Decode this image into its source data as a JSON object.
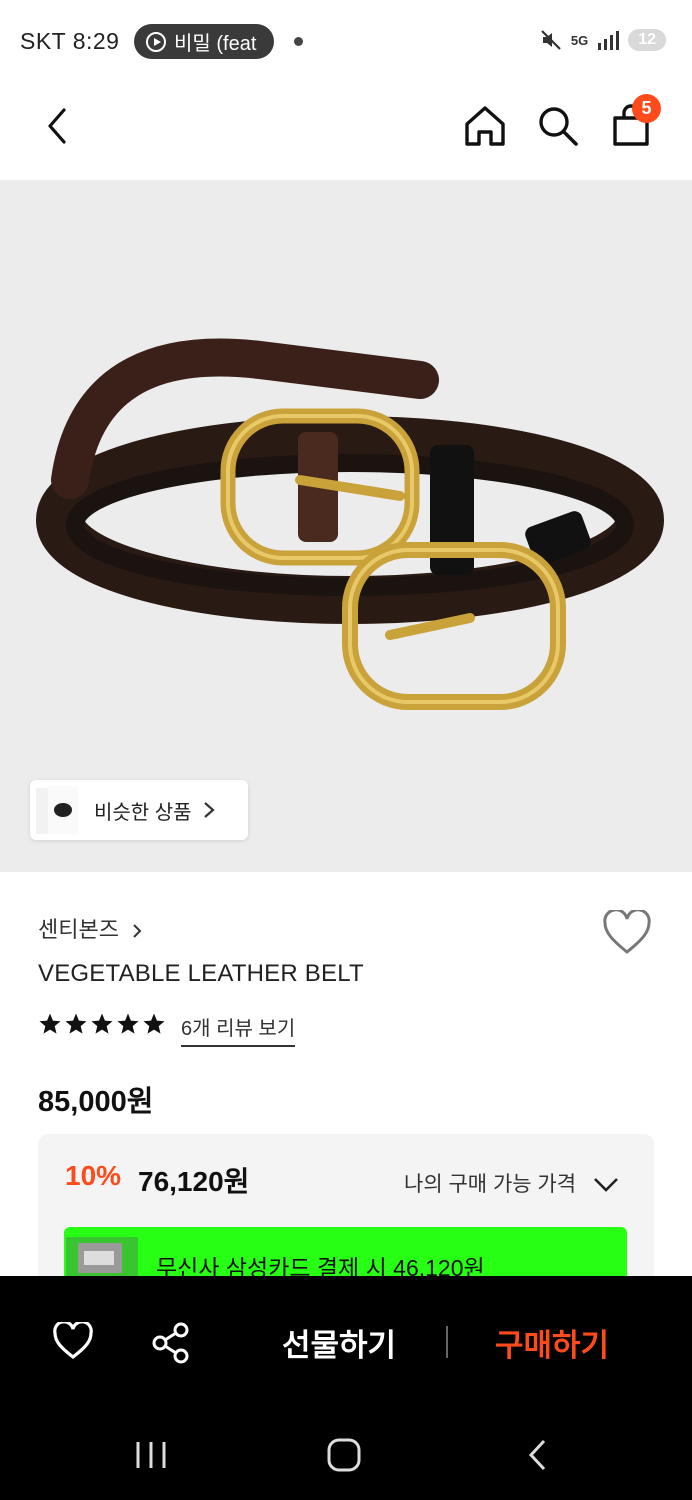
{
  "status_bar": {
    "carrier_time": "SKT 8:29",
    "media_text": "비밀 (feat",
    "network": "5G",
    "battery": "12"
  },
  "header": {
    "cart_count": "5"
  },
  "similar_products_label": "비슷한 상품",
  "product": {
    "brand": "센티본즈",
    "name": "VEGETABLE LEATHER BELT",
    "rating_stars": 5,
    "reviews_link": "6개 리뷰 보기",
    "price": "85,000원",
    "discount_rate": "10%",
    "sale_price": "76,120원",
    "my_price_label": "나의 구매 가능 가격",
    "card_promo": "무신사 삼성카드 결제 시 46,120원"
  },
  "actions": {
    "gift_label": "선물하기",
    "buy_label": "구매하기"
  },
  "colors": {
    "accent": "#ff4a1c",
    "promo_green": "#27ff14",
    "action_bar": "#000000"
  }
}
